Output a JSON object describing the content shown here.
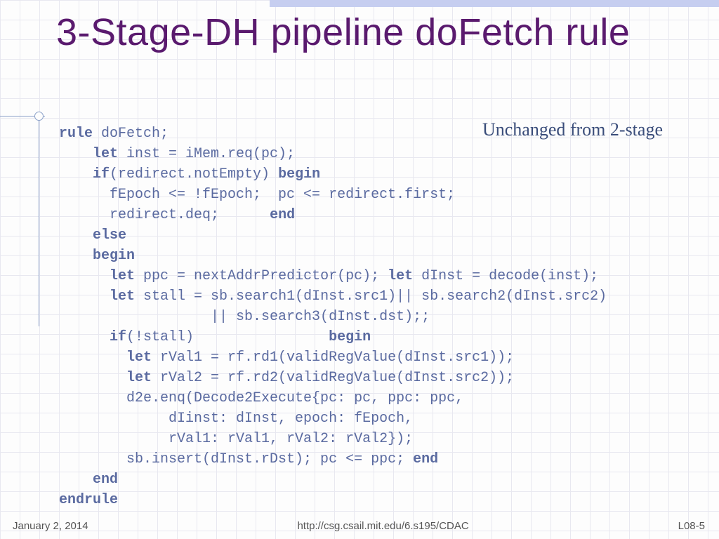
{
  "title": "3-Stage-DH pipeline doFetch rule",
  "subtitle": "Unchanged from 2-stage",
  "code": {
    "l1a": "rule",
    "l1b": " doFetch;",
    "l2a": "    let",
    "l2b": " inst = iMem.req(pc);",
    "l3a": "    if",
    "l3b": "(redirect.notEmpty) ",
    "l3c": "begin",
    "l4": "      fEpoch <= !fEpoch;  pc <= redirect.first;",
    "l5a": "      redirect.deq;      ",
    "l5b": "end",
    "l6": "    else",
    "l7": "    begin",
    "l8a": "      let",
    "l8b": " ppc = nextAddrPredictor(pc); ",
    "l8c": "let",
    "l8d": " dInst = decode(inst);",
    "l9a": "      let",
    "l9b": " stall = sb.search1(dInst.src1)|| sb.search2(dInst.src2)",
    "l10": "                  || sb.search3(dInst.dst);;",
    "l11a": "      if",
    "l11b": "(!stall)                ",
    "l11c": "begin",
    "l12a": "        let",
    "l12b": " rVal1 = rf.rd1(validRegValue(dInst.src1));",
    "l13a": "        let",
    "l13b": " rVal2 = rf.rd2(validRegValue(dInst.src2));",
    "l14": "        d2e.enq(Decode2Execute{pc: pc, ppc: ppc,",
    "l15": "             dIinst: dInst, epoch: fEpoch,",
    "l16": "             rVal1: rVal1, rVal2: rVal2});",
    "l17a": "        sb.insert(dInst.rDst); pc <= ppc; ",
    "l17b": "end",
    "l18": "    end",
    "l19": "endrule"
  },
  "footer": {
    "date": "January 2, 2014",
    "url": "http://csg.csail.mit.edu/6.s195/CDAC",
    "slide": "L08-5"
  }
}
